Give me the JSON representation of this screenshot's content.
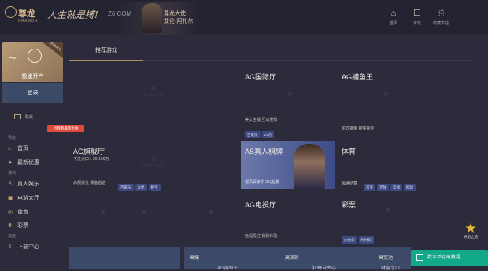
{
  "header": {
    "logo_cn": "尊龙",
    "logo_en": "DRAGON",
    "slogan": "人生就是搏!",
    "domain": "Z6.COM",
    "ambassador_line1": "尊龙大使",
    "ambassador_line2": "艾伦·阿扎尔",
    "icons": [
      {
        "name": "house-icon",
        "glyph": "⌂",
        "label": "首页"
      },
      {
        "name": "chat-icon",
        "glyph": "☐",
        "label": "论坛"
      },
      {
        "name": "bookmark-icon",
        "glyph": "⎘",
        "label": "收藏本站"
      }
    ]
  },
  "sidebar": {
    "open_account": "极速开户",
    "ribbon": "送8888元",
    "login": "登录",
    "transfer": "取款",
    "sections": [
      {
        "head": "导航",
        "items": [
          {
            "icon": "home-icon",
            "glyph": "⌂",
            "label": "首页"
          },
          {
            "icon": "gift-icon",
            "glyph": "✦",
            "label": "最新优惠"
          }
        ]
      },
      {
        "head": "游戏",
        "items": [
          {
            "icon": "person-icon",
            "glyph": "♙",
            "label": "真人娱乐"
          },
          {
            "icon": "gamepad-icon",
            "glyph": "▣",
            "label": "电游大厅"
          },
          {
            "icon": "ball-icon",
            "glyph": "◎",
            "label": "体育"
          },
          {
            "icon": "lottery-icon",
            "glyph": "✚",
            "label": "彩票"
          }
        ]
      },
      {
        "head": "其他",
        "items": [
          {
            "icon": "download-icon",
            "glyph": "⇩",
            "label": "下载中心"
          }
        ]
      }
    ],
    "tooltip": "点我看最新优惠"
  },
  "main": {
    "tab": "推荐游戏",
    "games": [
      {
        "title": "AG国际厅",
        "sub": "美女主播 互动发牌",
        "tags": [
          "百家乐",
          "21点"
        ]
      },
      {
        "title": "AG捕鱼王",
        "sub": "花式捕鱼 爽快掠金",
        "tags": []
      },
      {
        "title": "AG旗舰厅",
        "sub": "高额投注 豪客首选",
        "sub_top": "下注点口：20-100万",
        "tags": [
          "百家乐",
          "龙虎",
          "骰宝"
        ]
      },
      {
        "title": "AS真人棋牌",
        "sub": "视讯百家乐 5元起投",
        "tags": []
      },
      {
        "title": "体育",
        "sub": "极速结算",
        "tags": [
          "首页",
          "足球",
          "篮球",
          "网球"
        ]
      },
      {
        "title": "AG电投厅",
        "sub": "远程投注 极致体验",
        "tags": []
      },
      {
        "title": "彩票",
        "sub": "",
        "tags": [
          "六合彩",
          "时时彩"
        ]
      }
    ],
    "watermark_word": "DRAGON"
  },
  "bottom": {
    "col1_label": "高爆",
    "col1_sub": "AG捕鱼王",
    "col2_label": "高派彩",
    "col2_sub": "狂野自由心",
    "col3_label": "高奖池",
    "col3_sub": "财富之口"
  },
  "float": {
    "label": "导航之路",
    "tutorial": "数字币存取教程"
  }
}
